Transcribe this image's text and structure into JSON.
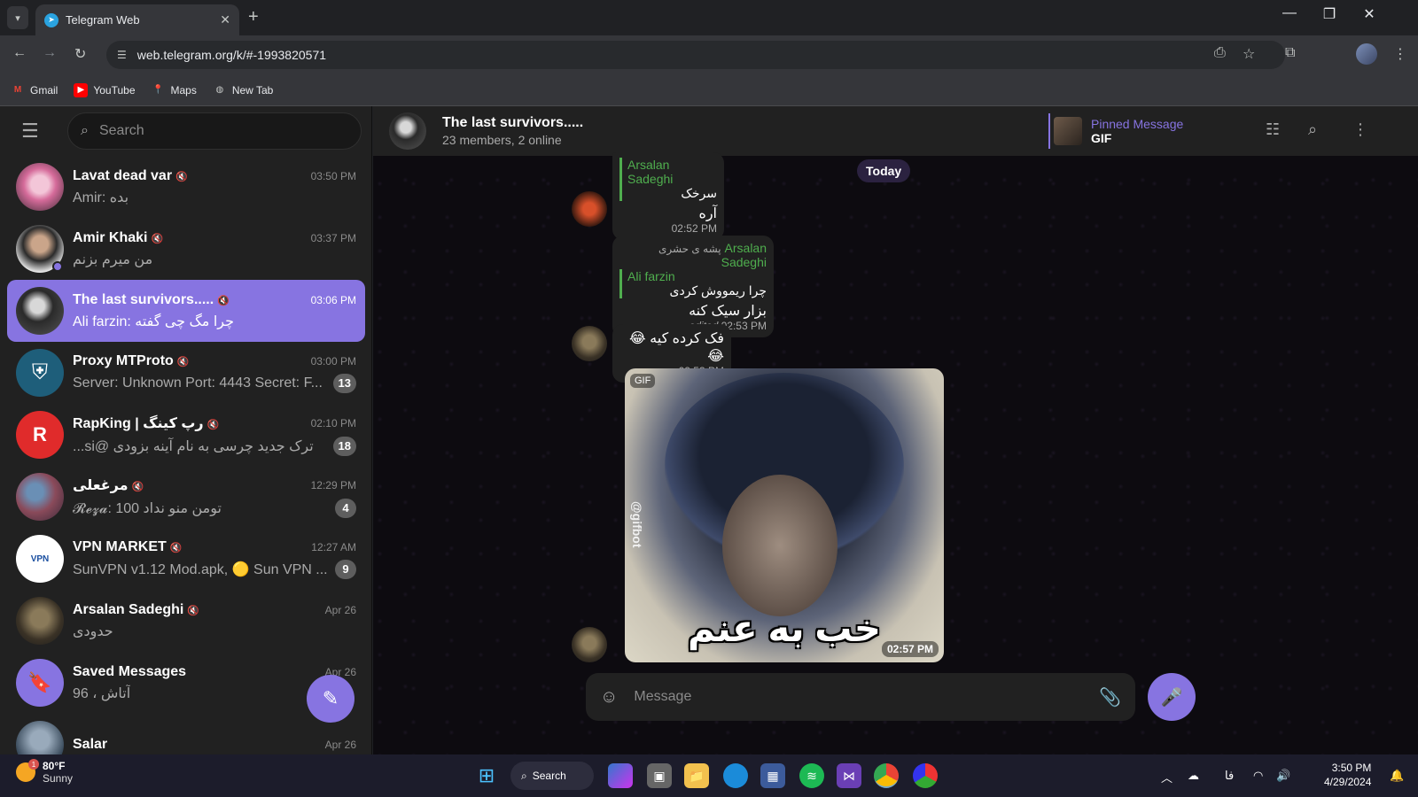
{
  "browser": {
    "tab_title": "Telegram Web",
    "url": "web.telegram.org/k/#-1993820571",
    "bookmarks": [
      {
        "label": "Gmail",
        "icon": "gmail-icon",
        "color": "#ea4335"
      },
      {
        "label": "YouTube",
        "icon": "youtube-icon",
        "color": "#ff0000"
      },
      {
        "label": "Maps",
        "icon": "maps-icon",
        "color": "#34a853"
      },
      {
        "label": "New Tab",
        "icon": "globe-icon",
        "color": "#9aa0a6"
      }
    ]
  },
  "sidebar": {
    "search_placeholder": "Search",
    "chats": [
      {
        "name": "Lavat dead var",
        "time": "03:50 PM",
        "preview": "Amir: بده",
        "badge": "",
        "muted": true,
        "active": false
      },
      {
        "name": "Amir Khaki",
        "time": "03:37 PM",
        "preview": "من میرم بزنم",
        "badge": "",
        "muted": true,
        "active": false,
        "online": true
      },
      {
        "name": "The last survivors.....",
        "time": "03:06 PM",
        "preview": "Ali farzin: چرا مگ چی گفته",
        "badge": "",
        "muted": true,
        "active": true
      },
      {
        "name": "Proxy MTProto",
        "time": "03:00 PM",
        "preview": "Server: Unknown Port: 4443 Secret: F...",
        "badge": "13",
        "muted": true,
        "active": false
      },
      {
        "name": "RapKing | رپ کینگ",
        "time": "02:10 PM",
        "preview": "ترک جدید چرسی به نام آینه بزودی @si...",
        "badge": "18",
        "muted": true,
        "active": false
      },
      {
        "name": "مرغعلی",
        "time": "12:29 PM",
        "preview": "𝓡𝓮𝔃𝓪: 100 تومن منو نداد",
        "badge": "4",
        "muted": true,
        "active": false
      },
      {
        "name": "VPN MARKET",
        "time": "12:27 AM",
        "preview": "SunVPN v1.12 Mod.apk, 🟡 Sun VPN ...",
        "badge": "9",
        "muted": true,
        "active": false
      },
      {
        "name": "Arsalan Sadeghi",
        "time": "Apr 26",
        "preview": "حدودی",
        "badge": "",
        "muted": true,
        "active": false
      },
      {
        "name": "Saved Messages",
        "time": "Apr 26",
        "preview": "96 ، آتاش",
        "badge": "",
        "muted": false,
        "active": false
      },
      {
        "name": "Salar",
        "time": "Apr 26",
        "preview": "",
        "badge": "",
        "muted": false,
        "active": false
      }
    ]
  },
  "chat": {
    "title": "The last survivors.....",
    "subtitle": "23 members, 2 online",
    "pinned_label": "Pinned Message",
    "pinned_text": "GIF",
    "date_chip": "Today",
    "messages": {
      "m1": {
        "reply_name": "Arsalan Sadeghi",
        "reply_text": "سرخک",
        "text": "آره",
        "time": "02:52 PM"
      },
      "m2": {
        "rank": "پشه ی حشری",
        "sender": "Arsalan Sadeghi",
        "reply_name": "Ali farzin",
        "reply_text": "چرا ریمووش کردی",
        "text": "بزار سیک کنه",
        "edited": "edited",
        "time": "02:53 PM"
      },
      "m3": {
        "text": "فک کرده کیه 😂😂",
        "time": "02:53 PM"
      },
      "m4": {
        "gif_label": "GIF",
        "watermark": "@gifbot",
        "caption": "خب به عنم",
        "time": "02:57 PM"
      }
    },
    "composer_placeholder": "Message"
  },
  "taskbar": {
    "weather_temp": "80°F",
    "weather_desc": "Sunny",
    "weather_badge": "1",
    "search_label": "Search",
    "lang": "فا",
    "time": "3:50 PM",
    "date": "4/29/2024"
  }
}
